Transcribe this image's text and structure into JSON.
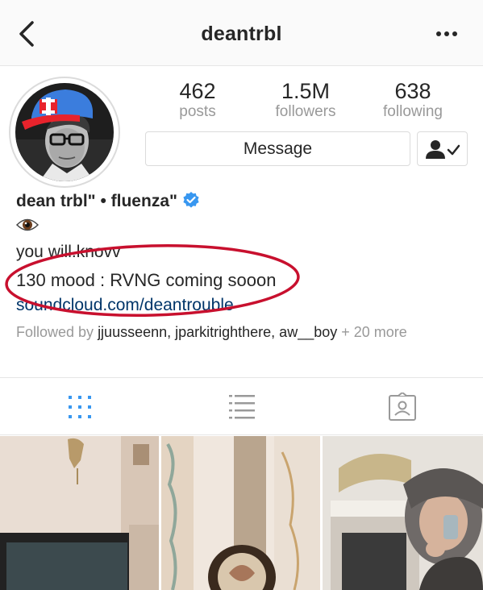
{
  "header": {
    "username": "deantrbl",
    "back_icon": "chevron-left-icon",
    "more_icon": "more-horizontal-icon"
  },
  "stats": {
    "posts": {
      "value": "462",
      "label": "posts"
    },
    "followers": {
      "value": "1.5M",
      "label": "followers"
    },
    "following": {
      "value": "638",
      "label": "following"
    }
  },
  "actions": {
    "message_label": "Message",
    "follow_icon": "user-check-icon"
  },
  "profile": {
    "name": "dean trbl\" • fluenza\"",
    "verified": true,
    "emoji_icon": "eye-emoji-icon",
    "bio_line1": "you will.knovv",
    "bio_line2": "130 mood : RVNG coming sooon",
    "website": "soundcloud.com/deantrouble"
  },
  "followed_by": {
    "prefix": "Followed by ",
    "names": "jjuusseenn, jparkitrighthere, aw__boy",
    "suffix": " + 20 more"
  },
  "tabs": [
    {
      "icon": "grid-icon",
      "active": true
    },
    {
      "icon": "list-icon",
      "active": false
    },
    {
      "icon": "tagged-photos-icon",
      "active": false
    }
  ],
  "colors": {
    "accent_blue": "#3897f0",
    "link": "#003569",
    "annotation_red": "#c8102e",
    "muted": "#999999"
  }
}
